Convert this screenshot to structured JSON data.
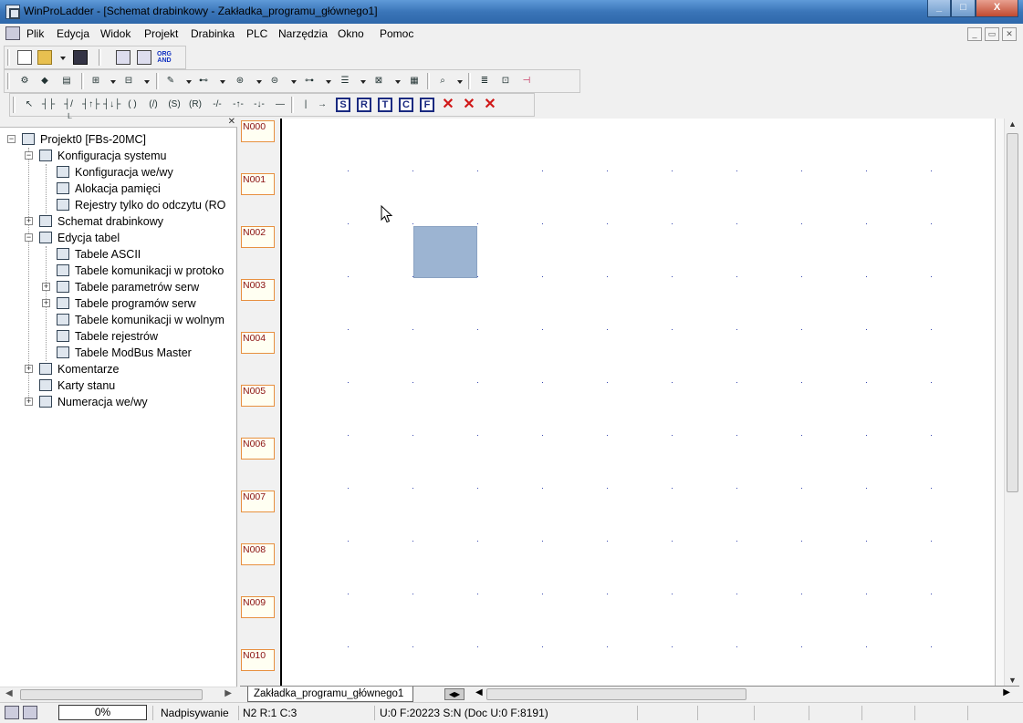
{
  "window": {
    "title": "WinProLadder - [Schemat drabinkowy - Zakładka_programu_głównego1]"
  },
  "menu": [
    "Plik",
    "Edycja",
    "Widok",
    "Projekt",
    "Drabinka",
    "PLC",
    "Narzędzia",
    "Okno",
    "Pomoc"
  ],
  "toolbar1": {
    "org_and_line1": "ORG",
    "org_and_line2": "AND"
  },
  "toolbar3": {
    "set_label": "S",
    "reset_label": "R",
    "timer_label": "T",
    "counter_label": "C",
    "function_label": "F"
  },
  "tree": {
    "root": "Projekt0 [FBs-20MC]",
    "items": [
      "Konfiguracja systemu",
      "Konfiguracja we/wy",
      "Alokacja pamięci",
      "Rejestry tylko do odczytu (RO",
      "Schemat drabinkowy",
      "Edycja tabel",
      "Tabele ASCII",
      "Tabele komunikacji w protoko",
      "Tabele parametrów serw",
      "Tabele programów serw",
      "Tabele komunikacji w wolnym",
      "Tabele rejestrów",
      "Tabele ModBus Master",
      "Komentarze",
      "Karty stanu",
      "Numeracja we/wy"
    ]
  },
  "ladder": {
    "networks": [
      "N000",
      "N001",
      "N002",
      "N003",
      "N004",
      "N005",
      "N006",
      "N007",
      "N008",
      "N009",
      "N010"
    ]
  },
  "tabs": {
    "active": "Zakładka_programu_głównego1"
  },
  "status": {
    "progress": "0%",
    "mode": "Nadpisywanie",
    "position": "N2 R:1 C:3",
    "memory": "U:0 F:20223 S:N (Doc U:0 F:8191)"
  },
  "colors": {
    "title_bar": "#3a75b8",
    "selection": "#9cb4d2",
    "network_label_border": "#e79040",
    "network_label_text": "#8a1010"
  }
}
